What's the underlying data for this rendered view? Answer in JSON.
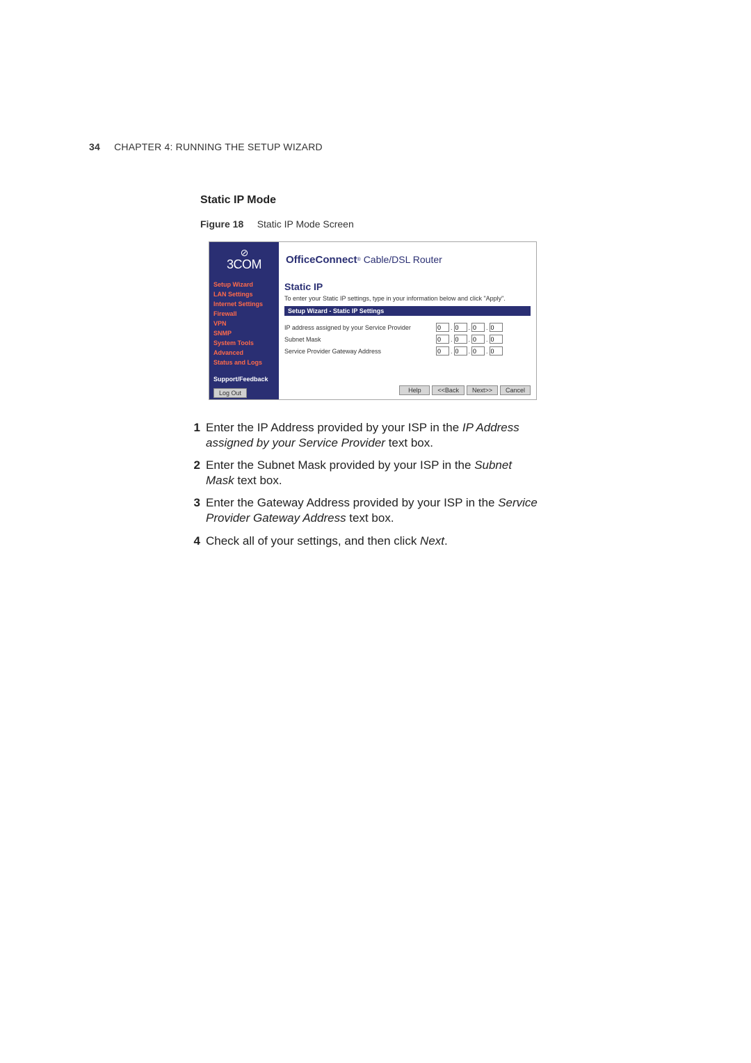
{
  "page_header": {
    "page_number": "34",
    "chapter_label_pre": "C",
    "chapter_label_rest": "HAPTER 4: R",
    "chapter_label_rest2": "UNNING THE S",
    "chapter_label_rest3": "ETUP W",
    "chapter_label_rest4": "IZARD"
  },
  "section_heading": "Static IP Mode",
  "figure": {
    "label": "Figure 18",
    "caption": "Static IP Mode Screen"
  },
  "router": {
    "brand_swirl": "⊘",
    "brand_text": "3COM",
    "product_name": "OfficeConnect",
    "product_reg": "®",
    "product_suffix": "Cable/DSL Router",
    "nav": {
      "items": [
        "Setup Wizard",
        "LAN Settings",
        "Internet Settings",
        "Firewall",
        "VPN",
        "SNMP",
        "System Tools",
        "Advanced",
        "Status and Logs"
      ],
      "support": "Support/Feedback",
      "logout": "Log Out"
    },
    "main": {
      "title": "Static IP",
      "intro": "To enter your Static IP settings, type in your information below and click \"Apply\".",
      "section_bar": "Setup Wizard - Static IP Settings",
      "rows": [
        {
          "label": "IP address assigned by your Service Provider",
          "v": [
            "0",
            "0",
            "0",
            "0"
          ]
        },
        {
          "label": "Subnet Mask",
          "v": [
            "0",
            "0",
            "0",
            "0"
          ]
        },
        {
          "label": "Service Provider Gateway Address",
          "v": [
            "0",
            "0",
            "0",
            "0"
          ]
        }
      ],
      "buttons": {
        "help": "Help",
        "back": "<<Back",
        "next": "Next>>",
        "cancel": "Cancel"
      }
    }
  },
  "steps": {
    "s1a": "Enter the IP Address provided by your ISP in the ",
    "s1i": "IP Address assigned by your Service Provider",
    "s1b": " text box.",
    "s2a": "Enter the Subnet Mask provided by your ISP in the ",
    "s2i": "Subnet Mask",
    "s2b": " text box.",
    "s3a": "Enter the Gateway Address provided by your ISP in the ",
    "s3i": "Service Provider Gateway Address",
    "s3b": " text box.",
    "s4a": "Check all of your settings, and then click ",
    "s4i": "Next",
    "s4b": "."
  },
  "nums": {
    "n1": "1",
    "n2": "2",
    "n3": "3",
    "n4": "4"
  }
}
